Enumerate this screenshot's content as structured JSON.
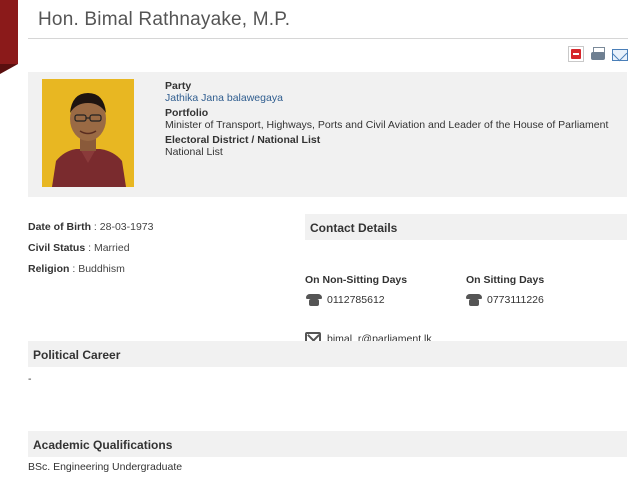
{
  "page": {
    "title": "Hon. Bimal Rathnayake, M.P."
  },
  "toolbar": {
    "icons": [
      "pdf-icon",
      "print-icon",
      "mail-icon"
    ]
  },
  "profile": {
    "party_label": "Party",
    "party_value": "Jathika Jana balawegaya",
    "portfolio_label": "Portfolio",
    "portfolio_value": "Minister of Transport, Highways, Ports and Civil Aviation and Leader of the House of Parliament",
    "district_label": "Electoral District / National List",
    "district_value": "National List"
  },
  "personal": {
    "dob_label": "Date of Birth",
    "dob_value": "28-03-1973",
    "civil_label": "Civil Status",
    "civil_value": "Married",
    "religion_label": "Religion",
    "religion_value": "Buddhism"
  },
  "contact": {
    "header": "Contact Details",
    "non_sitting_title": "On Non-Sitting Days",
    "non_sitting_phone": "0112785612",
    "sitting_title": "On Sitting Days",
    "sitting_phone": "0773111226",
    "email": "bimal_r@parliament.lk"
  },
  "career": {
    "header": "Political Career",
    "body": "-"
  },
  "academic": {
    "header": "Academic Qualifications",
    "body": "BSc. Engineering Undergraduate"
  },
  "colors": {
    "ribbon": "#8b1a1a",
    "panel_bg": "#f1f1f1",
    "link": "#2f5d8f",
    "photo_bg": "#e8b722"
  }
}
